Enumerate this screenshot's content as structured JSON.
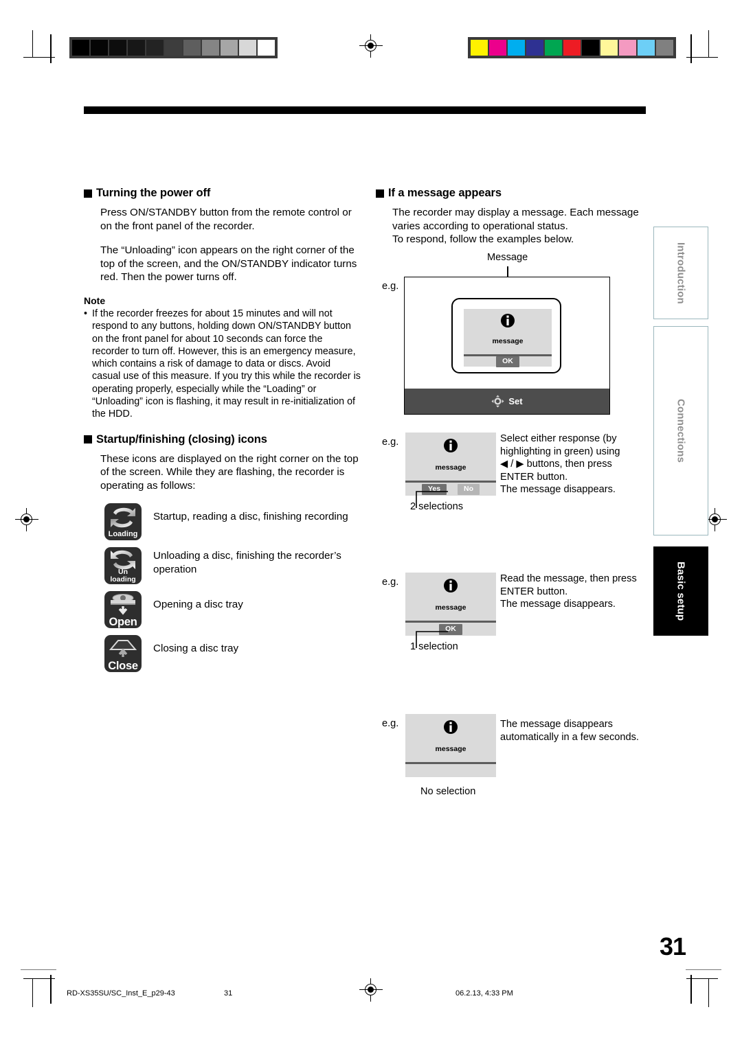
{
  "document": {
    "page_number": "31",
    "footer_filename": "RD-XS35SU/SC_Inst_E_p29-43",
    "footer_page": "31",
    "footer_timestamp": "06.2.13, 4:33 PM"
  },
  "left_column": {
    "section1": {
      "heading": "Turning the power off",
      "paragraph1": "Press ON/STANDBY button from the remote control or on the front panel of the recorder.",
      "paragraph2": "The “Unloading” icon appears on the right corner of the top of the screen, and the ON/STANDBY indicator turns red. Then the power turns off.",
      "note_heading": "Note",
      "note_items": [
        "If the recorder freezes for about 15 minutes and will not respond to any buttons, holding down ON/STANDBY button on the front panel for about 10 seconds can force the recorder to turn off. However, this is an emergency measure, which contains a risk of damage to data or discs. Avoid casual use of this measure. If you try this while the recorder is operating properly, especially while the “Loading” or “Unloading” icon is flashing, it may result in re-initialization of the HDD."
      ]
    },
    "section2": {
      "heading": "Startup/finishing (closing) icons",
      "paragraph1": "These icons are displayed on the right corner on the top of the screen. While they are flashing, the recorder is operating as follows:",
      "icons": [
        {
          "icon_label": "Loading",
          "icon_name": "loading-icon",
          "description": "Startup, reading a disc, finishing recording"
        },
        {
          "icon_label": "Un loading",
          "icon_label_line1": "Un",
          "icon_label_line2": "loading",
          "icon_name": "unloading-icon",
          "description": "Unloading a disc, finishing the recorder’s operation"
        },
        {
          "icon_label": "Open",
          "icon_name": "tray-open-icon",
          "description": "Opening a disc tray"
        },
        {
          "icon_label": "Close",
          "icon_name": "tray-close-icon",
          "description": "Closing a disc tray"
        }
      ]
    }
  },
  "right_column": {
    "heading": "If a message appears",
    "paragraph1": "The recorder may display a message. Each message varies according to operational status.",
    "paragraph2": "To respond, follow the examples below.",
    "diagram": {
      "callout_label": "Message",
      "eg_label": "e.g.",
      "message_word": "message",
      "ok_button": "OK",
      "status_bar_label": "Set",
      "dpad_icon": "dpad-icon",
      "info_icon": "info-icon"
    },
    "examples": [
      {
        "eg_label": "e.g.",
        "message_word": "message",
        "buttons": [
          "Yes",
          "No"
        ],
        "selected_button": "Yes",
        "caption": "2 selections",
        "description": "Select either response (by highlighting in green) using ◀ / ▶ buttons, then press ENTER button.\nThe message disappears.",
        "description_lines": [
          "Select either response (by",
          "highlighting in green) using",
          "◀ / ▶ buttons, then press",
          "ENTER button.",
          "The message disappears."
        ]
      },
      {
        "eg_label": "e.g.",
        "message_word": "message",
        "buttons": [
          "OK"
        ],
        "selected_button": "OK",
        "caption": "1 selection",
        "description_lines": [
          "Read the message, then press",
          "ENTER button.",
          "The message disappears."
        ]
      },
      {
        "eg_label": "e.g.",
        "message_word": "message",
        "buttons": [],
        "caption": "No selection",
        "description_lines": [
          "The message disappears",
          "automatically in a few seconds."
        ]
      }
    ]
  },
  "side_tabs": [
    {
      "label": "Introduction",
      "active": false
    },
    {
      "label": "Connections",
      "active": false
    },
    {
      "label": "Basic setup",
      "active": true
    }
  ],
  "calibration": {
    "grayscale_patches": [
      "#000000",
      "#050505",
      "#0d0d0d",
      "#171717",
      "#232323",
      "#3d3d3d",
      "#5e5e5e",
      "#858585",
      "#a6a6a6",
      "#d8d8d8",
      "#ffffff"
    ],
    "color_patches": [
      "#fff200",
      "#ec008c",
      "#00aeef",
      "#2e3192",
      "#00a651",
      "#ed1c24",
      "#000000",
      "#fff79a",
      "#f49ac1",
      "#6dcff6",
      "#808080"
    ]
  },
  "colors": {
    "accent_dark": "#2e2e2e",
    "panel_gray": "#dadada",
    "statusbar_gray": "#4d4d4d",
    "tab_outline": "#9bb7bd"
  }
}
